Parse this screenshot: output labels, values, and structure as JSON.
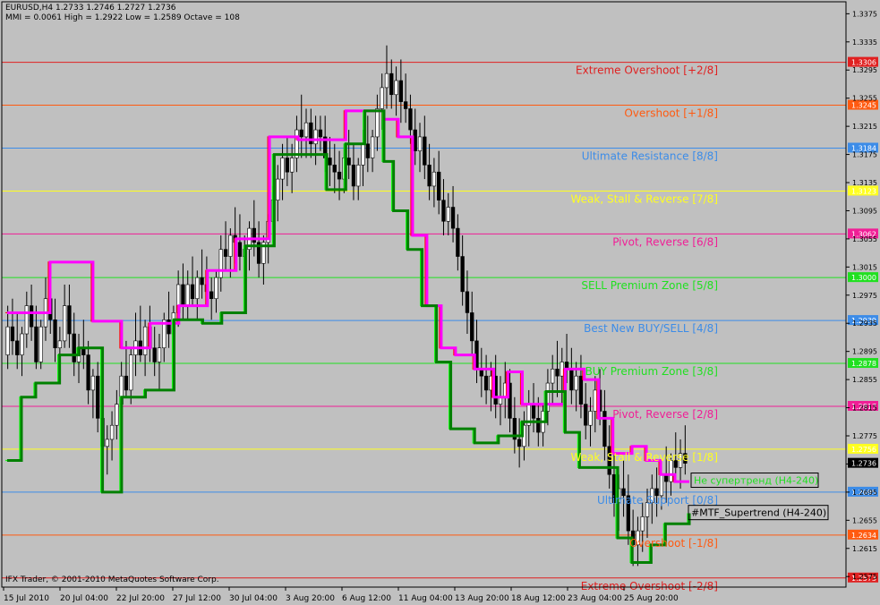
{
  "header": {
    "line1": "EURUSD,H4  1.2733 1.2746 1.2727 1.2736",
    "line2": "MMI = 0.0061   High = 1.2922   Low = 1.2589   Octave = 108"
  },
  "footer": {
    "copyright": "IFX Trader, © 2001-2010 MetaQuotes Software Corp."
  },
  "colors": {
    "background": "#c0c0c0",
    "frame": "#000000",
    "bull_candle": "#ffffff",
    "bear_candle": "#000000"
  },
  "chart_data": {
    "type": "candlestick",
    "symbol": "EURUSD",
    "timeframe": "H4",
    "ylim": [
      1.256,
      1.3392
    ],
    "y_ticks": [
      "1.3375",
      "1.3335",
      "1.3295",
      "1.3255",
      "1.3215",
      "1.3175",
      "1.3135",
      "1.3095",
      "1.3055",
      "1.3015",
      "1.2975",
      "1.2935",
      "1.2895",
      "1.2855",
      "1.2815",
      "1.2775",
      "1.2735",
      "1.2695",
      "1.2655",
      "1.2615",
      "1.2575"
    ],
    "x_ticks": [
      "15 Jul 2010",
      "20 Jul 04:00",
      "22 Jul 20:00",
      "27 Jul 12:00",
      "30 Jul 04:00",
      "3 Aug 20:00",
      "6 Aug 12:00",
      "11 Aug 04:00",
      "13 Aug 20:00",
      "18 Aug 12:00",
      "23 Aug 04:00",
      "25 Aug 20:00"
    ],
    "current_price": "1.2736",
    "murrey_levels": [
      {
        "price": 1.3306,
        "label": "1.3306",
        "name": "Extreme Overshoot [+2/8]",
        "color": "#e02020"
      },
      {
        "price": 1.3245,
        "label": "1.3245",
        "name": "Overshoot [+1/8]",
        "color": "#ff5a10"
      },
      {
        "price": 1.3184,
        "label": "1.3184",
        "name": "Ultimate Resistance [8/8]",
        "color": "#3c8ce8"
      },
      {
        "price": 1.3123,
        "label": "1.3123",
        "name": "Weak, Stall & Reverse [7/8]",
        "color": "#ffff20"
      },
      {
        "price": 1.3062,
        "label": "1.3062",
        "name": "Pivot, Reverse [6/8]",
        "color": "#f01e96"
      },
      {
        "price": 1.3,
        "label": "1.3000",
        "name": "SELL Premium Zone [5/8]",
        "color": "#20e020"
      },
      {
        "price": 1.2939,
        "label": "1.2939",
        "name": "Best New BUY/SELL [4/8]",
        "color": "#3c8ce8"
      },
      {
        "price": 1.2878,
        "label": "1.2878",
        "name": "BUY Premium Zone [3/8]",
        "color": "#20e020"
      },
      {
        "price": 1.2817,
        "label": "1.2817",
        "name": "Pivot, Reverse [2/8]",
        "color": "#f01e96"
      },
      {
        "price": 1.2756,
        "label": "1.2756",
        "name": "Weak, Stall & Reverse [1/8]",
        "color": "#ffff20"
      },
      {
        "price": 1.2695,
        "label": "1.2695",
        "name": "Ultimate Support [0/8]",
        "color": "#3c8ce8"
      },
      {
        "price": 1.2634,
        "label": "1.2634",
        "name": "Overshoot [-1/8]",
        "color": "#ff5a10"
      },
      {
        "price": 1.2573,
        "label": "1.2573",
        "name": "Extreme Overshoot [-2/8]",
        "color": "#e02020"
      }
    ],
    "indicator_labels": [
      {
        "text": "Не супертренд (H4-240)",
        "price": 1.2712,
        "color": "#20e020"
      },
      {
        "text": "#MTF_Supertrend (H4-240)",
        "price": 1.2666,
        "color": "#000000"
      }
    ],
    "series": [
      {
        "name": "Не супертренд (H4-240)",
        "style": "upper",
        "color": "#ff00ff",
        "alt_color": "#ff0000",
        "points": [
          [
            0,
            1.295
          ],
          [
            8,
            1.295
          ],
          [
            18,
            1.3022
          ],
          [
            30,
            1.3022
          ],
          [
            36,
            1.2938
          ],
          [
            48,
            1.29
          ],
          [
            60,
            1.2935
          ],
          [
            72,
            1.296
          ],
          [
            84,
            1.301
          ],
          [
            96,
            1.3055
          ],
          [
            110,
            1.32
          ],
          [
            122,
            1.3196
          ],
          [
            134,
            1.3196
          ],
          [
            142,
            1.3237
          ],
          [
            150,
            1.3237
          ],
          [
            158,
            1.3225
          ],
          [
            164,
            1.32
          ],
          [
            170,
            1.306
          ],
          [
            176,
            1.296
          ],
          [
            182,
            1.29
          ],
          [
            188,
            1.289
          ],
          [
            196,
            1.287
          ],
          [
            204,
            1.283
          ],
          [
            210,
            1.2866
          ],
          [
            216,
            1.282
          ],
          [
            226,
            1.282
          ],
          [
            234,
            1.287
          ],
          [
            242,
            1.2855
          ],
          [
            248,
            1.28
          ],
          [
            254,
            1.275
          ],
          [
            262,
            1.276
          ],
          [
            268,
            1.274
          ],
          [
            274,
            1.272
          ],
          [
            280,
            1.271
          ],
          [
            286,
            1.271
          ]
        ]
      },
      {
        "name": "#MTF_Supertrend (H4-240)",
        "style": "lower",
        "color": "#008000",
        "alt_color": "#00ff00",
        "points": [
          [
            0,
            1.274
          ],
          [
            6,
            1.283
          ],
          [
            12,
            1.285
          ],
          [
            22,
            1.289
          ],
          [
            30,
            1.29
          ],
          [
            40,
            1.2695
          ],
          [
            48,
            1.283
          ],
          [
            58,
            1.284
          ],
          [
            70,
            1.294
          ],
          [
            82,
            1.2935
          ],
          [
            90,
            1.295
          ],
          [
            100,
            1.3045
          ],
          [
            112,
            1.3175
          ],
          [
            122,
            1.3175
          ],
          [
            134,
            1.3125
          ],
          [
            142,
            1.319
          ],
          [
            150,
            1.3237
          ],
          [
            158,
            1.3165
          ],
          [
            162,
            1.3095
          ],
          [
            168,
            1.304
          ],
          [
            174,
            1.296
          ],
          [
            180,
            1.288
          ],
          [
            186,
            1.2785
          ],
          [
            196,
            1.2765
          ],
          [
            206,
            1.2775
          ],
          [
            216,
            1.2795
          ],
          [
            226,
            1.2838
          ],
          [
            234,
            1.278
          ],
          [
            240,
            1.273
          ],
          [
            248,
            1.273
          ],
          [
            256,
            1.263
          ],
          [
            262,
            1.2595
          ],
          [
            270,
            1.262
          ],
          [
            276,
            1.265
          ],
          [
            286,
            1.2665
          ]
        ]
      }
    ],
    "candles_ohlc": [
      [
        1.289,
        1.296,
        1.287,
        1.293
      ],
      [
        1.293,
        1.297,
        1.289,
        1.291
      ],
      [
        1.291,
        1.295,
        1.287,
        1.289
      ],
      [
        1.289,
        1.293,
        1.286,
        1.292
      ],
      [
        1.292,
        1.298,
        1.29,
        1.296
      ],
      [
        1.296,
        1.299,
        1.291,
        1.293
      ],
      [
        1.293,
        1.296,
        1.287,
        1.288
      ],
      [
        1.288,
        1.294,
        1.287,
        1.293
      ],
      [
        1.293,
        1.3,
        1.291,
        1.297
      ],
      [
        1.297,
        1.3,
        1.292,
        1.294
      ],
      [
        1.294,
        1.297,
        1.288,
        1.29
      ],
      [
        1.29,
        1.293,
        1.286,
        1.291
      ],
      [
        1.291,
        1.299,
        1.29,
        1.296
      ],
      [
        1.296,
        1.299,
        1.29,
        1.292
      ],
      [
        1.292,
        1.295,
        1.286,
        1.288
      ],
      [
        1.288,
        1.292,
        1.285,
        1.29
      ],
      [
        1.29,
        1.294,
        1.287,
        1.289
      ],
      [
        1.289,
        1.291,
        1.282,
        1.284
      ],
      [
        1.284,
        1.287,
        1.28,
        1.286
      ],
      [
        1.286,
        1.288,
        1.278,
        1.28
      ],
      [
        1.28,
        1.283,
        1.272,
        1.276
      ],
      [
        1.276,
        1.279,
        1.272,
        1.277
      ],
      [
        1.277,
        1.281,
        1.274,
        1.279
      ],
      [
        1.279,
        1.284,
        1.277,
        1.282
      ],
      [
        1.282,
        1.288,
        1.279,
        1.286
      ],
      [
        1.286,
        1.291,
        1.283,
        1.284
      ],
      [
        1.284,
        1.29,
        1.282,
        1.289
      ],
      [
        1.289,
        1.295,
        1.286,
        1.291
      ],
      [
        1.291,
        1.296,
        1.288,
        1.289
      ],
      [
        1.289,
        1.294,
        1.286,
        1.293
      ],
      [
        1.293,
        1.296,
        1.288,
        1.29
      ],
      [
        1.29,
        1.293,
        1.286,
        1.288
      ],
      [
        1.288,
        1.292,
        1.284,
        1.29
      ],
      [
        1.29,
        1.295,
        1.288,
        1.294
      ],
      [
        1.294,
        1.298,
        1.29,
        1.292
      ],
      [
        1.292,
        1.296,
        1.289,
        1.295
      ],
      [
        1.295,
        1.301,
        1.293,
        1.299
      ],
      [
        1.299,
        1.302,
        1.294,
        1.296
      ],
      [
        1.296,
        1.301,
        1.294,
        1.299
      ],
      [
        1.299,
        1.303,
        1.296,
        1.297
      ],
      [
        1.297,
        1.301,
        1.294,
        1.3
      ],
      [
        1.3,
        1.304,
        1.297,
        1.299
      ],
      [
        1.299,
        1.303,
        1.296,
        1.298
      ],
      [
        1.298,
        1.3,
        1.294,
        1.297
      ],
      [
        1.297,
        1.301,
        1.295,
        1.3
      ],
      [
        1.3,
        1.306,
        1.298,
        1.304
      ],
      [
        1.304,
        1.308,
        1.301,
        1.303
      ],
      [
        1.303,
        1.307,
        1.3,
        1.306
      ],
      [
        1.306,
        1.31,
        1.302,
        1.305
      ],
      [
        1.305,
        1.309,
        1.301,
        1.303
      ],
      [
        1.303,
        1.306,
        1.299,
        1.304
      ],
      [
        1.304,
        1.308,
        1.301,
        1.307
      ],
      [
        1.307,
        1.311,
        1.303,
        1.305
      ],
      [
        1.305,
        1.308,
        1.3,
        1.302
      ],
      [
        1.302,
        1.306,
        1.299,
        1.305
      ],
      [
        1.305,
        1.309,
        1.302,
        1.308
      ],
      [
        1.308,
        1.313,
        1.305,
        1.311
      ],
      [
        1.311,
        1.316,
        1.308,
        1.314
      ],
      [
        1.314,
        1.319,
        1.311,
        1.317
      ],
      [
        1.317,
        1.32,
        1.313,
        1.315
      ],
      [
        1.315,
        1.319,
        1.312,
        1.317
      ],
      [
        1.317,
        1.323,
        1.315,
        1.321
      ],
      [
        1.321,
        1.326,
        1.317,
        1.32
      ],
      [
        1.32,
        1.324,
        1.317,
        1.322
      ],
      [
        1.322,
        1.324,
        1.317,
        1.319
      ],
      [
        1.319,
        1.323,
        1.316,
        1.321
      ],
      [
        1.321,
        1.323,
        1.318,
        1.32
      ],
      [
        1.32,
        1.323,
        1.315,
        1.317
      ],
      [
        1.317,
        1.32,
        1.313,
        1.316
      ],
      [
        1.316,
        1.319,
        1.312,
        1.315
      ],
      [
        1.315,
        1.318,
        1.311,
        1.314
      ],
      [
        1.314,
        1.319,
        1.312,
        1.317
      ],
      [
        1.317,
        1.321,
        1.314,
        1.316
      ],
      [
        1.316,
        1.319,
        1.311,
        1.313
      ],
      [
        1.313,
        1.317,
        1.311,
        1.316
      ],
      [
        1.316,
        1.321,
        1.313,
        1.319
      ],
      [
        1.319,
        1.323,
        1.315,
        1.317
      ],
      [
        1.317,
        1.321,
        1.315,
        1.32
      ],
      [
        1.32,
        1.326,
        1.318,
        1.324
      ],
      [
        1.324,
        1.329,
        1.321,
        1.327
      ],
      [
        1.327,
        1.333,
        1.324,
        1.329
      ],
      [
        1.329,
        1.331,
        1.324,
        1.326
      ],
      [
        1.326,
        1.33,
        1.323,
        1.328
      ],
      [
        1.328,
        1.331,
        1.322,
        1.325
      ],
      [
        1.325,
        1.329,
        1.322,
        1.324
      ],
      [
        1.324,
        1.326,
        1.319,
        1.321
      ],
      [
        1.321,
        1.324,
        1.316,
        1.318
      ],
      [
        1.318,
        1.322,
        1.315,
        1.32
      ],
      [
        1.32,
        1.323,
        1.314,
        1.316
      ],
      [
        1.316,
        1.319,
        1.311,
        1.313
      ],
      [
        1.313,
        1.317,
        1.31,
        1.315
      ],
      [
        1.315,
        1.318,
        1.309,
        1.311
      ],
      [
        1.311,
        1.314,
        1.306,
        1.308
      ],
      [
        1.308,
        1.312,
        1.306,
        1.31
      ],
      [
        1.31,
        1.313,
        1.305,
        1.307
      ],
      [
        1.307,
        1.309,
        1.301,
        1.303
      ],
      [
        1.303,
        1.306,
        1.296,
        1.298
      ],
      [
        1.298,
        1.301,
        1.292,
        1.295
      ],
      [
        1.295,
        1.298,
        1.289,
        1.291
      ],
      [
        1.291,
        1.294,
        1.285,
        1.287
      ],
      [
        1.287,
        1.29,
        1.283,
        1.286
      ],
      [
        1.286,
        1.289,
        1.282,
        1.284
      ],
      [
        1.284,
        1.288,
        1.281,
        1.286
      ],
      [
        1.286,
        1.289,
        1.28,
        1.282
      ],
      [
        1.282,
        1.286,
        1.279,
        1.283
      ],
      [
        1.283,
        1.288,
        1.28,
        1.285
      ],
      [
        1.285,
        1.287,
        1.278,
        1.28
      ],
      [
        1.28,
        1.283,
        1.275,
        1.277
      ],
      [
        1.277,
        1.28,
        1.273,
        1.276
      ],
      [
        1.276,
        1.281,
        1.274,
        1.279
      ],
      [
        1.279,
        1.284,
        1.276,
        1.282
      ],
      [
        1.282,
        1.285,
        1.278,
        1.28
      ],
      [
        1.28,
        1.283,
        1.276,
        1.278
      ],
      [
        1.278,
        1.282,
        1.276,
        1.281
      ],
      [
        1.281,
        1.287,
        1.279,
        1.285
      ],
      [
        1.285,
        1.289,
        1.282,
        1.287
      ],
      [
        1.287,
        1.291,
        1.283,
        1.286
      ],
      [
        1.286,
        1.29,
        1.282,
        1.288
      ],
      [
        1.288,
        1.292,
        1.285,
        1.287
      ],
      [
        1.287,
        1.29,
        1.282,
        1.284
      ],
      [
        1.284,
        1.288,
        1.281,
        1.286
      ],
      [
        1.286,
        1.289,
        1.28,
        1.282
      ],
      [
        1.282,
        1.285,
        1.277,
        1.279
      ],
      [
        1.279,
        1.283,
        1.276,
        1.281
      ],
      [
        1.281,
        1.286,
        1.278,
        1.284
      ],
      [
        1.284,
        1.287,
        1.279,
        1.281
      ],
      [
        1.281,
        1.284,
        1.274,
        1.276
      ],
      [
        1.276,
        1.279,
        1.27,
        1.272
      ],
      [
        1.272,
        1.275,
        1.266,
        1.268
      ],
      [
        1.268,
        1.272,
        1.264,
        1.27
      ],
      [
        1.27,
        1.274,
        1.266,
        1.269
      ],
      [
        1.269,
        1.272,
        1.262,
        1.264
      ],
      [
        1.264,
        1.267,
        1.259,
        1.262
      ],
      [
        1.262,
        1.266,
        1.259,
        1.264
      ],
      [
        1.264,
        1.268,
        1.261,
        1.266
      ],
      [
        1.266,
        1.27,
        1.263,
        1.268
      ],
      [
        1.268,
        1.272,
        1.265,
        1.27
      ],
      [
        1.27,
        1.273,
        1.266,
        1.269
      ],
      [
        1.269,
        1.274,
        1.267,
        1.272
      ],
      [
        1.272,
        1.276,
        1.268,
        1.271
      ],
      [
        1.271,
        1.275,
        1.269,
        1.274
      ],
      [
        1.274,
        1.278,
        1.271,
        1.273
      ],
      [
        1.273,
        1.277,
        1.27,
        1.275
      ],
      [
        1.275,
        1.279,
        1.272,
        1.2736
      ]
    ]
  }
}
